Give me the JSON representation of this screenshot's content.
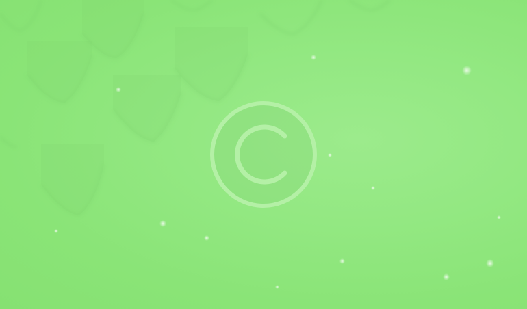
{
  "background": {
    "base_color": "#8ae477",
    "highlight_color": "#9ceb8c",
    "scale_shadow_color": "#6fc460"
  },
  "watermark": {
    "icon": "copyright-icon",
    "color": "#b4f0a6"
  }
}
